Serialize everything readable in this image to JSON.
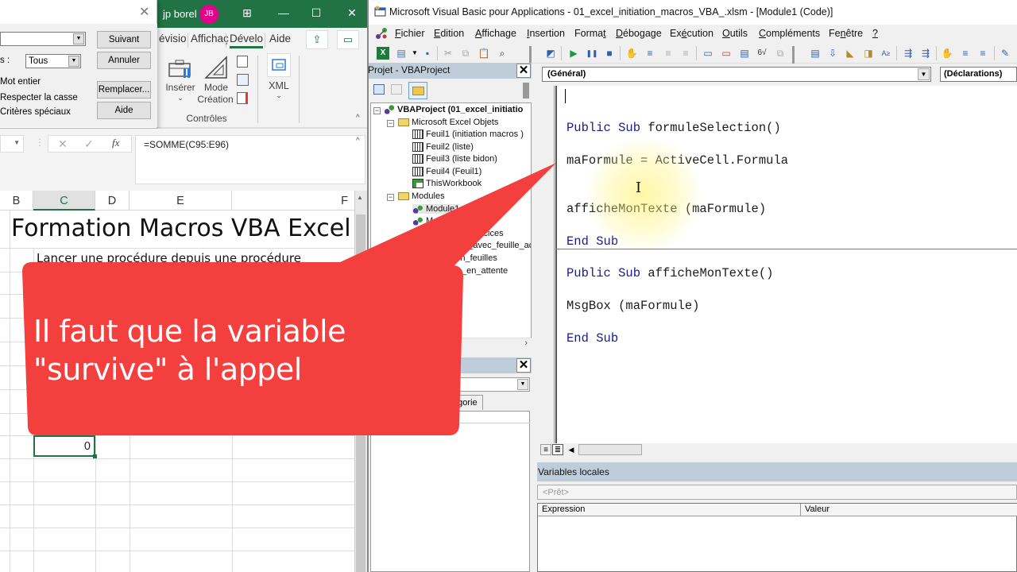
{
  "excel": {
    "user_name": "jp borel",
    "user_initials": "JB",
    "ribbon_tabs": [
      "évisio",
      "Affichaç",
      "Dévelo",
      "Aide"
    ],
    "active_tab": "Dévelo",
    "ribbon_buttons": {
      "insert": "Insérer",
      "design_mode_line1": "Mode",
      "design_mode_line2": "Création",
      "xml": "XML",
      "group_label": "Contrôles"
    },
    "find_dialog": {
      "search_in_value": "",
      "scope_label": "s :",
      "scope_value": "Tous",
      "options": [
        "Mot entier",
        "Respecter la casse",
        "Critères spéciaux"
      ],
      "buttons": {
        "next": "Suivant",
        "cancel": "Annuler",
        "replace": "Remplacer...",
        "help": "Aide"
      }
    },
    "formula_bar": {
      "fx_label": "fx",
      "formula": "=SOMME(C95:E96)"
    },
    "columns": [
      "B",
      "C",
      "D",
      "E",
      "F"
    ],
    "selected_column": "C",
    "sheet_title": "Formation Macros VBA Excel",
    "sheet_subtitle": "Lancer une procédure depuis une procédure",
    "active_cell_value": "0"
  },
  "vbe": {
    "window_title": "Microsoft Visual Basic pour Applications - 01_excel_initiation_macros_VBA_.xlsm - [Module1 (Code)]",
    "menu": [
      {
        "label": "Fichier",
        "accel": "F"
      },
      {
        "label": "Edition",
        "accel": "E"
      },
      {
        "label": "Affichage",
        "accel": "A"
      },
      {
        "label": "Insertion",
        "accel": "I"
      },
      {
        "label": "Format",
        "accel": "t"
      },
      {
        "label": "Débogage",
        "accel": "D"
      },
      {
        "label": "Exécution",
        "accel": "é"
      },
      {
        "label": "Outils",
        "accel": "O"
      },
      {
        "label": "Compléments",
        "accel": "C"
      },
      {
        "label": "Fenêtre",
        "accel": "n"
      },
      {
        "label": "?",
        "accel": "?"
      }
    ],
    "project_pane": {
      "title": "Projet - VBAProject",
      "tree": {
        "root": "VBAProject (01_excel_initiatio",
        "excel_objects_folder": "Microsoft Excel Objets",
        "sheets": [
          "Feuil1 (initiation macros )",
          "Feuil2 (liste)",
          "Feuil3 (liste bidon)",
          "Feuil4 (Feuil1)",
          "ThisWorkbook"
        ],
        "modules_folder": "Modules",
        "modules": [
          "Module1",
          "M",
          "_exercices",
          "erPdf_avec_feuille_ac",
          "gestion_feuilles",
          "_en_attente"
        ]
      }
    },
    "properties_pane": {
      "tab_category": "égorie"
    },
    "code_window": {
      "object_combo": "(Général)",
      "procedure_combo": "(Déclarations)",
      "procedure1": {
        "signature": {
          "kw1": "Public",
          "kw2": "Sub",
          "name": " formuleSelection()"
        },
        "line1": "maFormule = ActiveCell.Formula",
        "line2": "afficheMonTexte (maFormule)",
        "end": {
          "kw1": "End",
          "kw2": "Sub"
        }
      },
      "procedure2": {
        "signature": {
          "kw1": "Public",
          "kw2": "Sub",
          "name": " afficheMonTexte()"
        },
        "line1": "MsgBox (maFormule)",
        "end": {
          "kw1": "End",
          "kw2": "Sub"
        }
      }
    },
    "locals_window": {
      "title": "Variables locales",
      "status": "<Prêt>",
      "columns": [
        "Expression",
        "Valeur"
      ]
    }
  },
  "callout": {
    "line1": "Il faut que la variable",
    "line2": "\"survive\" à l'appel",
    "color": "#f43f3f"
  }
}
